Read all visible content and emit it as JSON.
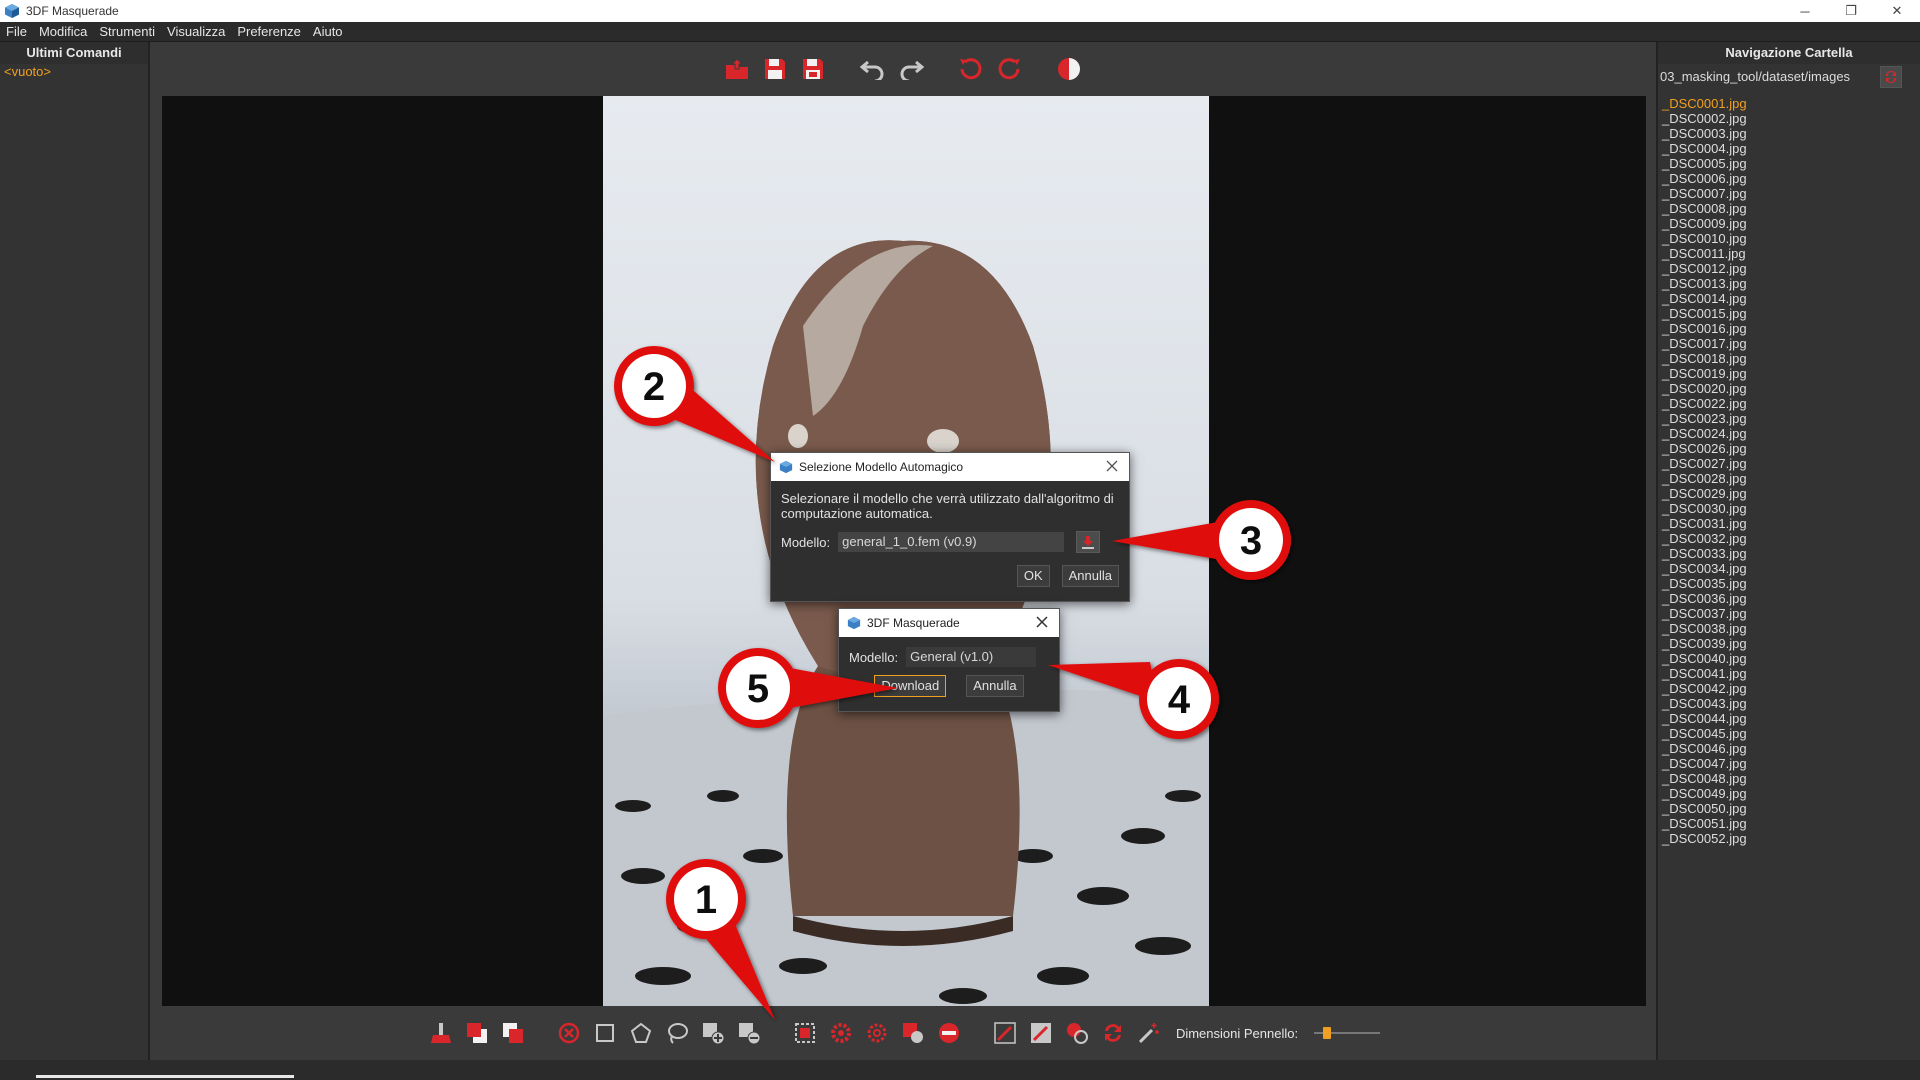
{
  "window": {
    "title": "3DF Masquerade",
    "minimize": "─",
    "restore": "❐",
    "close": "✕"
  },
  "menu": [
    "File",
    "Modifica",
    "Strumenti",
    "Visualizza",
    "Preferenze",
    "Aiuto"
  ],
  "left_panel": {
    "header": "Ultimi Comandi",
    "empty": "<vuoto>"
  },
  "right_panel": {
    "header": "Navigazione Cartella",
    "path": "03_masking_tool/dataset/images",
    "files": [
      "_DSC0001.jpg",
      "_DSC0002.jpg",
      "_DSC0003.jpg",
      "_DSC0004.jpg",
      "_DSC0005.jpg",
      "_DSC0006.jpg",
      "_DSC0007.jpg",
      "_DSC0008.jpg",
      "_DSC0009.jpg",
      "_DSC0010.jpg",
      "_DSC0011.jpg",
      "_DSC0012.jpg",
      "_DSC0013.jpg",
      "_DSC0014.jpg",
      "_DSC0015.jpg",
      "_DSC0016.jpg",
      "_DSC0017.jpg",
      "_DSC0018.jpg",
      "_DSC0019.jpg",
      "_DSC0020.jpg",
      "_DSC0022.jpg",
      "_DSC0023.jpg",
      "_DSC0024.jpg",
      "_DSC0026.jpg",
      "_DSC0027.jpg",
      "_DSC0028.jpg",
      "_DSC0029.jpg",
      "_DSC0030.jpg",
      "_DSC0031.jpg",
      "_DSC0032.jpg",
      "_DSC0033.jpg",
      "_DSC0034.jpg",
      "_DSC0035.jpg",
      "_DSC0036.jpg",
      "_DSC0037.jpg",
      "_DSC0038.jpg",
      "_DSC0039.jpg",
      "_DSC0040.jpg",
      "_DSC0041.jpg",
      "_DSC0042.jpg",
      "_DSC0043.jpg",
      "_DSC0044.jpg",
      "_DSC0045.jpg",
      "_DSC0046.jpg",
      "_DSC0047.jpg",
      "_DSC0048.jpg",
      "_DSC0049.jpg",
      "_DSC0050.jpg",
      "_DSC0051.jpg",
      "_DSC0052.jpg"
    ],
    "active_index": 0
  },
  "top_toolbar_icons": [
    "open-folder-icon",
    "save-icon",
    "save-all-icon",
    "undo-icon",
    "redo-icon",
    "rotate-left-icon",
    "rotate-right-icon",
    "invert-mask-icon"
  ],
  "bottom_toolbar_icons": [
    "brush-clear-icon",
    "mask-add-icon",
    "mask-subtract-icon",
    "clear-mask-icon",
    "rectangle-tool-icon",
    "polygon-tool-icon",
    "lasso-tool-icon",
    "add-region-icon",
    "remove-region-icon",
    "ai-auto-mask-icon",
    "ai-settings-icon",
    "settings-icon",
    "global-mask-icon",
    "stop-icon",
    "brush-add-icon",
    "brush-remove-icon",
    "paint-circle-icon",
    "swap-icon",
    "magic-wand-icon"
  ],
  "brush": {
    "label": "Dimensioni Pennello:",
    "value": 0.15
  },
  "dialog_model": {
    "title": "Selezione Modello Automagico",
    "description": "Selezionare il modello che verrà utilizzato dall'algoritmo di computazione automatica.",
    "model_label": "Modello:",
    "model_value": "general_1_0.fem (v0.9)",
    "ok": "OK",
    "cancel": "Annulla"
  },
  "dialog_download": {
    "title": "3DF Masquerade",
    "model_label": "Modello:",
    "model_value": "General (v1.0)",
    "download": "Download",
    "cancel": "Annulla"
  },
  "callouts": [
    "1",
    "2",
    "3",
    "4",
    "5"
  ],
  "colors": {
    "accent": "#f0a020",
    "callout_red": "#e01010",
    "icon_red": "#d9262b"
  }
}
